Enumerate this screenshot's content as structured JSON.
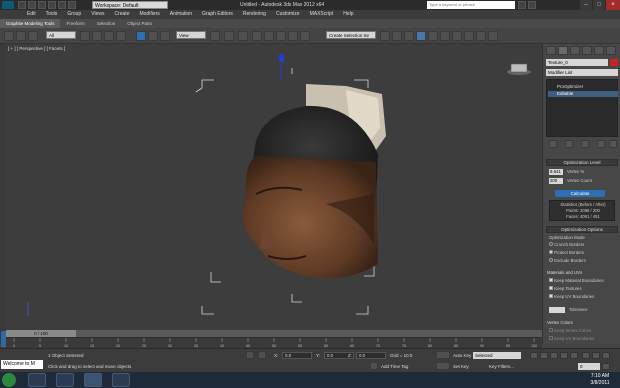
{
  "window": {
    "workspace_select": "Workspace: Default",
    "title": "Untitled - Autodesk 3ds Max 2012 x64",
    "search_placeholder": "Type a keyword or phrase"
  },
  "menu": [
    "Edit",
    "Tools",
    "Group",
    "Views",
    "Create",
    "Modifiers",
    "Animation",
    "Graph Editors",
    "Rendering",
    "Customize",
    "MAXScript",
    "Help"
  ],
  "ribbon": {
    "tabs": [
      "Graphite Modeling Tools",
      "Freeform",
      "Selection",
      "Object Paint"
    ]
  },
  "toolbar": {
    "selection_filter": "All",
    "ref_coord": "View",
    "named_selection": "Create Selection Se"
  },
  "viewport": {
    "label": "[ + ] [ Perspective ] [ Facets ]"
  },
  "command_panel": {
    "object_name": "Texture_0",
    "modifier_list": "Modifier List",
    "stack": [
      "ProOptimizer",
      "Editable"
    ],
    "optimization_level": {
      "title": "Optimization Level",
      "vertex_percent_value": "9.641",
      "vertex_percent_label": "Vertex %",
      "vertex_count_value": "200",
      "vertex_count_label": "Vertex Count",
      "calculate": "Calculate",
      "stats_title": "Statistics (Before / After)",
      "stats_points": "Points: 2096 / 200",
      "stats_faces": "Faces: 4091 / 451"
    },
    "optimization_options": {
      "title": "Optimization Options",
      "mode_label": "Optimization Mode",
      "modes": [
        "Crunch Borders",
        "Protect Borders",
        "Exclude Borders"
      ]
    },
    "materials_uvs": {
      "title": "Materials and UVs",
      "options": [
        "Keep Material Boundaries",
        "Keep Textures",
        "Keep UV Boundaries"
      ],
      "tolerance_label": "Tolerance"
    },
    "vertex_colors": {
      "title": "Vertex Colors",
      "options": [
        "Keep Vertex Colors",
        "Keep UV Boundaries"
      ]
    }
  },
  "timeline": {
    "slider": "0 / 100",
    "ticks": [
      "0",
      "5",
      "10",
      "15",
      "20",
      "25",
      "30",
      "35",
      "40",
      "45",
      "50",
      "55",
      "60",
      "65",
      "70",
      "75",
      "80",
      "85",
      "90",
      "95",
      "100"
    ]
  },
  "status": {
    "line1": "1 Object Selected",
    "line2": "Click and drag to select and move objects",
    "x_label": "X:",
    "y_label": "Y:",
    "z_label": "Z:",
    "x_value": "0.0",
    "y_value": "0.0",
    "z_value": "0.0",
    "grid": "Grid = 10.0",
    "add_time_tag": "Add Time Tag",
    "auto_key": "Auto Key",
    "set_key": "Set Key",
    "selected": "Selected",
    "key_filters": "Key Filters...",
    "frame": "0",
    "welcome": "Welcome to M"
  },
  "taskbar": {
    "time": "7:10 AM",
    "date": "3/8/2011"
  },
  "colors": {
    "accent": "#2d6fb3",
    "object_color": "#cc2222",
    "viewport_bg": "#3d3d3d"
  }
}
